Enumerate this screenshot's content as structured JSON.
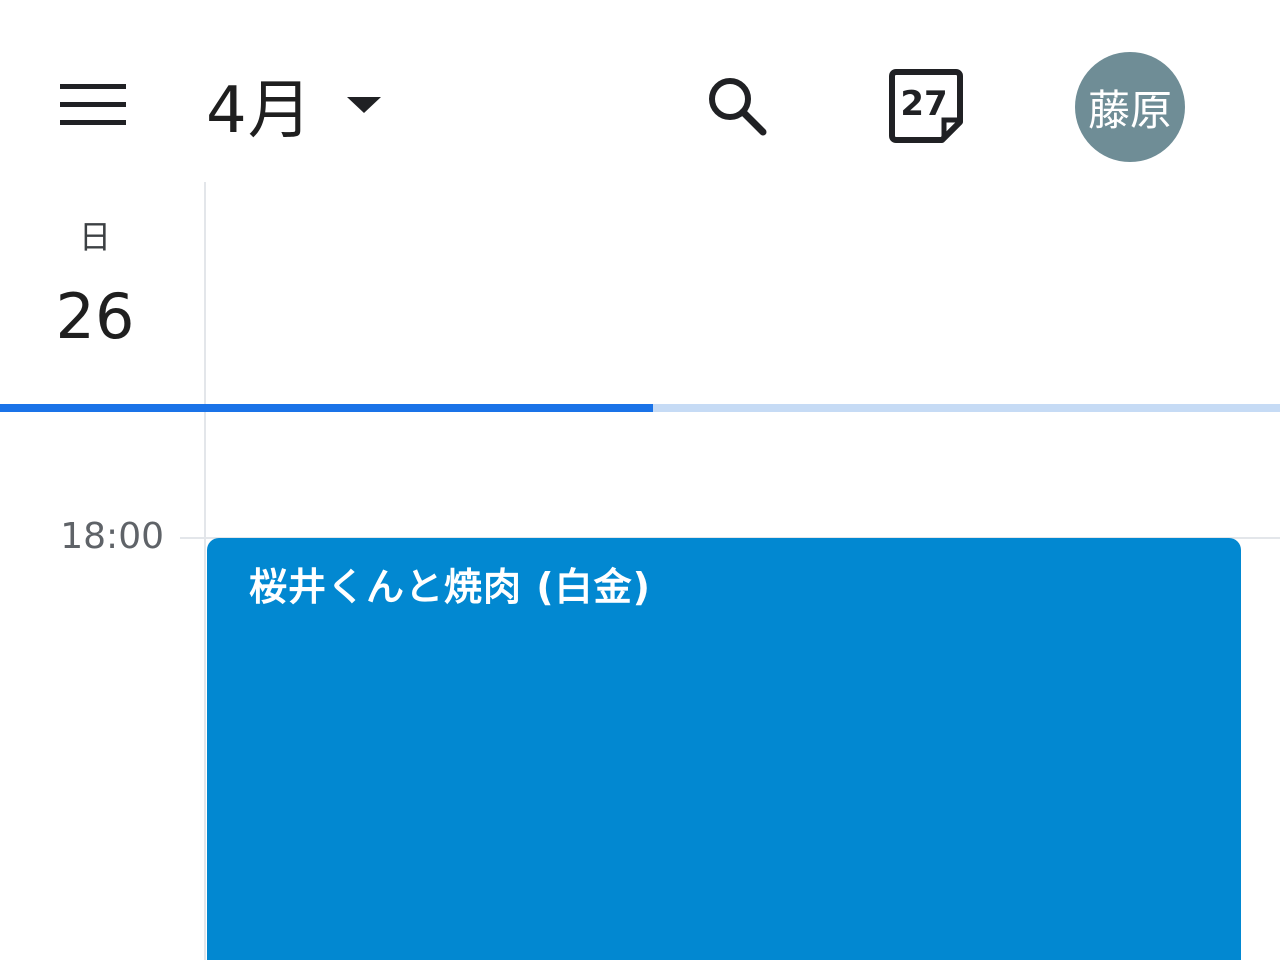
{
  "header": {
    "month_label": "4月",
    "today_day": "27",
    "avatar_text": "藤原"
  },
  "day": {
    "weekday": "日",
    "date": "26"
  },
  "progress": {
    "fraction": 0.51
  },
  "timeline": {
    "time_label": "18:00"
  },
  "event": {
    "title": "桜井くんと焼肉 (白金)",
    "color": "#0288d1"
  },
  "colors": {
    "accent": "#1a73e8",
    "avatar_bg": "#6f8d96"
  },
  "icons": {
    "menu": "menu-icon",
    "dropdown": "chevron-down-icon",
    "search": "search-icon",
    "today": "calendar-today-icon"
  }
}
